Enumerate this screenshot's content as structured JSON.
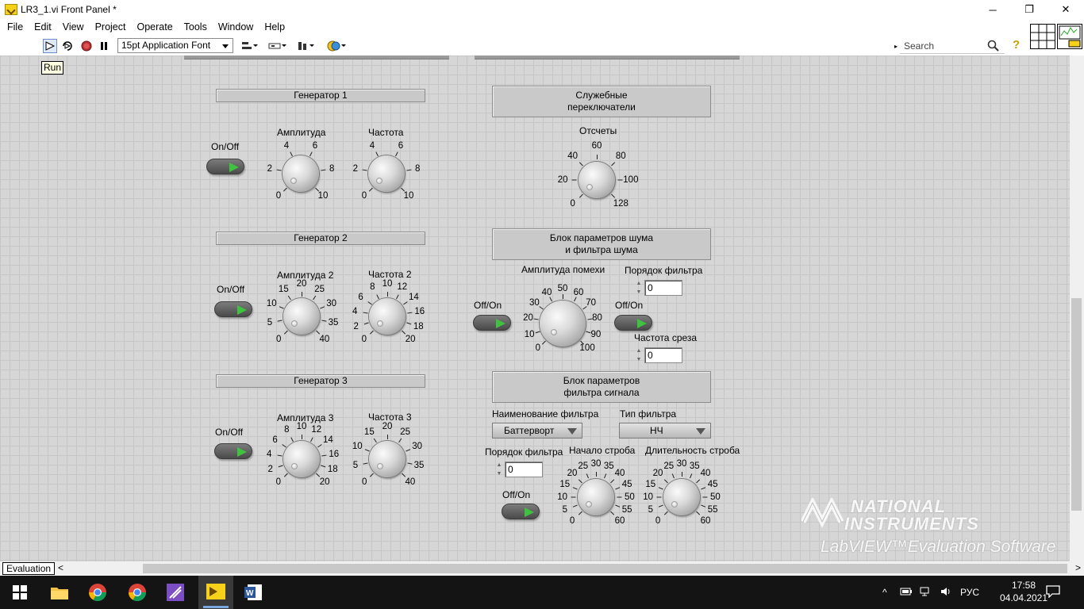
{
  "window": {
    "title": "LR3_1.vi Front Panel *",
    "minimize": "─",
    "restore": "❐",
    "close": "✕"
  },
  "menu": [
    "File",
    "Edit",
    "View",
    "Project",
    "Operate",
    "Tools",
    "Window",
    "Help"
  ],
  "toolbar": {
    "font": "15pt Application Font",
    "search_placeholder": "Search",
    "tooltip": "Run",
    "run_icon": "run-arrow-icon",
    "run_continuous_icon": "run-continuously-icon",
    "abort_icon": "abort-icon",
    "pause_icon": "pause-icon"
  },
  "panel": {
    "generators": [
      {
        "title": "Генератор 1",
        "switch_label": "On/Off",
        "amp": {
          "label": "Амплитуда",
          "ticks": [
            "0",
            "2",
            "4",
            "6",
            "8",
            "10"
          ]
        },
        "freq": {
          "label": "Частота",
          "ticks": [
            "0",
            "2",
            "4",
            "6",
            "8",
            "10"
          ]
        }
      },
      {
        "title": "Генератор 2",
        "switch_label": "On/Off",
        "amp": {
          "label": "Амплитуда 2",
          "ticks": [
            "0",
            "5",
            "10",
            "15",
            "20",
            "25",
            "30",
            "35",
            "40"
          ]
        },
        "freq": {
          "label": "Частота 2",
          "ticks": [
            "0",
            "2",
            "4",
            "6",
            "8",
            "10",
            "12",
            "14",
            "16",
            "18",
            "20"
          ]
        }
      },
      {
        "title": "Генератор 3",
        "switch_label": "On/Off",
        "amp": {
          "label": "Амплитуда 3",
          "ticks": [
            "0",
            "2",
            "4",
            "6",
            "8",
            "10",
            "12",
            "14",
            "16",
            "18",
            "20"
          ]
        },
        "freq": {
          "label": "Частота 3",
          "ticks": [
            "0",
            "5",
            "10",
            "15",
            "20",
            "25",
            "30",
            "35",
            "40"
          ]
        }
      }
    ],
    "service": {
      "title_l1": "Служебные",
      "title_l2": "переключатели",
      "samples": {
        "label": "Отсчеты",
        "ticks": [
          "0",
          "20",
          "40",
          "60",
          "80",
          "100",
          "128"
        ]
      }
    },
    "noise": {
      "title_l1": "Блок параметров шума",
      "title_l2": "и фильтра шума",
      "switch_label": "Off/On",
      "amp": {
        "label": "Амплитуда помехи",
        "ticks": [
          "0",
          "10",
          "20",
          "30",
          "40",
          "50",
          "60",
          "70",
          "80",
          "90",
          "100"
        ]
      },
      "order_label": "Порядок фильтра",
      "order_value": "0",
      "filter_switch_label": "Off/On",
      "cutoff_label": "Частота среза",
      "cutoff_value": "0"
    },
    "signal_filter": {
      "title_l1": "Блок параметров",
      "title_l2": "фильтра сигнала",
      "name_label": "Наименование фильтра",
      "name_value": "Баттерворт",
      "type_label": "Тип фильтра",
      "type_value": "НЧ",
      "order_label": "Порядок фильтра",
      "order_value": "0",
      "switch_label": "Off/On",
      "gate_start": {
        "label": "Начало строба",
        "ticks": [
          "0",
          "5",
          "10",
          "15",
          "20",
          "25",
          "30",
          "35",
          "40",
          "45",
          "50",
          "55",
          "60"
        ]
      },
      "gate_length": {
        "label": "Длительность строба",
        "ticks": [
          "0",
          "5",
          "10",
          "15",
          "20",
          "25",
          "30",
          "35",
          "40",
          "45",
          "50",
          "55",
          "60"
        ]
      }
    },
    "watermark": {
      "line1": "NATIONAL",
      "line2": "INSTRUMENTS",
      "line3": "LabVIEW™Evaluation Software"
    }
  },
  "statusbar": {
    "label": "Evaluation"
  },
  "taskbar": {
    "language": "РУС",
    "time": "17:58",
    "date": "04.04.2021"
  }
}
